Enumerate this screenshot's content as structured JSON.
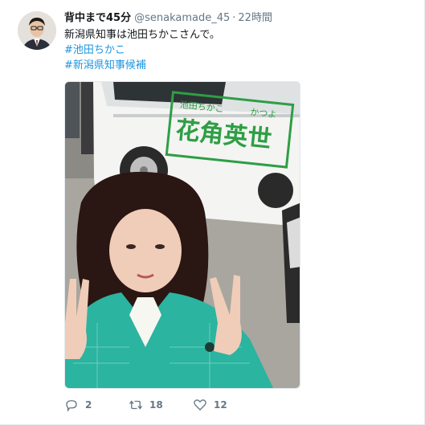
{
  "user": {
    "display_name": "背中まで45分",
    "handle": "@senakamade_45",
    "separator": "·",
    "time": "22時間"
  },
  "tweet": {
    "text": "新潟県知事は池田ちかこさんで。",
    "hashtags": [
      "#池田ちかこ",
      "#新潟県知事候補"
    ]
  },
  "photo": {
    "van_sign_small": "池田ちかこ",
    "van_sign_furigana": "かつよ",
    "van_sign_large": "花角英世"
  },
  "actions": {
    "reply_count": "2",
    "retweet_count": "18",
    "like_count": "12"
  },
  "icons": {
    "reply": "reply-icon",
    "retweet": "retweet-icon",
    "like": "heart-icon"
  },
  "colors": {
    "link": "#1b95e0",
    "muted": "#657786",
    "jacket": "#2bb4a0",
    "van_sign": "#2e9e45"
  }
}
